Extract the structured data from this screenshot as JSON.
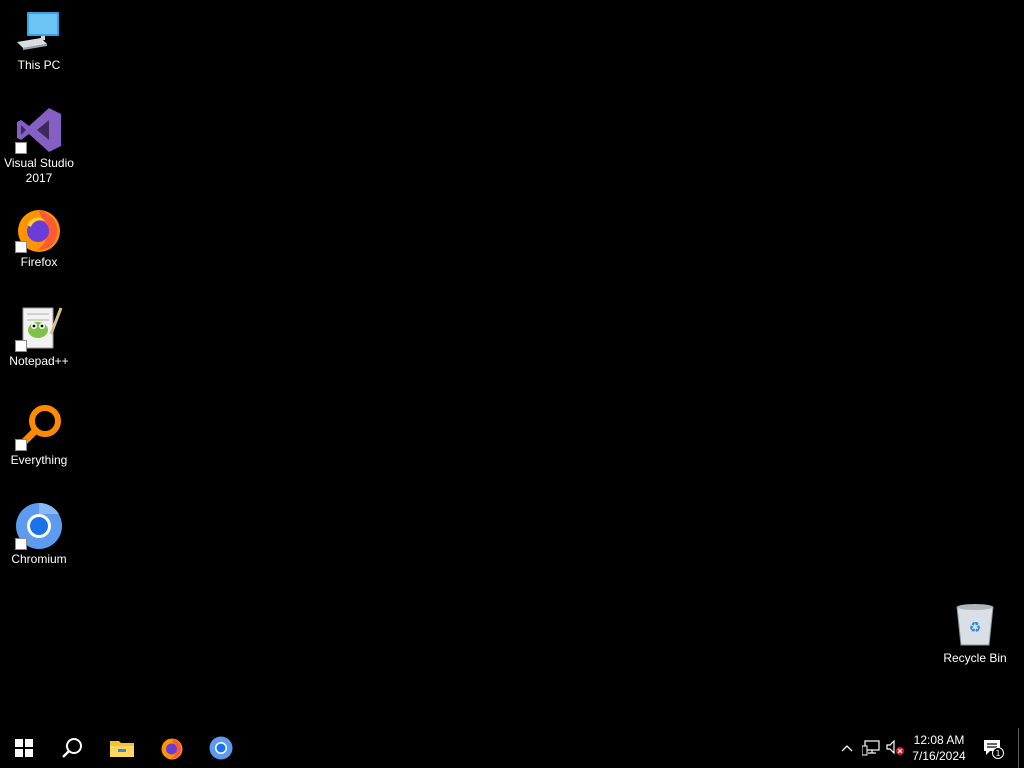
{
  "desktop": {
    "icons": [
      {
        "label": "This PC",
        "icon": "computer-icon"
      },
      {
        "label": "Visual Studio 2017",
        "icon": "visual-studio-icon"
      },
      {
        "label": "Firefox",
        "icon": "firefox-icon"
      },
      {
        "label": "Notepad++",
        "icon": "notepadpp-icon"
      },
      {
        "label": "Everything",
        "icon": "everything-icon"
      },
      {
        "label": "Chromium",
        "icon": "chromium-icon"
      }
    ],
    "recycle_bin": {
      "label": "Recycle Bin",
      "icon": "recycle-bin-icon"
    }
  },
  "taskbar": {
    "buttons": [
      {
        "icon": "windows-start-icon"
      },
      {
        "icon": "search-icon"
      },
      {
        "icon": "file-explorer-icon"
      },
      {
        "icon": "firefox-icon"
      },
      {
        "icon": "chromium-icon"
      }
    ],
    "tray": {
      "icons": [
        "chevron-up-icon",
        "network-icon",
        "volume-muted-icon"
      ],
      "time": "12:08 AM",
      "date": "7/16/2024",
      "notifications": {
        "icon": "action-center-icon",
        "count": "1"
      }
    }
  },
  "colors": {
    "background": "#000000",
    "text": "#ffffff",
    "visual_studio": "#865fc5",
    "firefox_orange": "#ff9400",
    "chromium_blue": "#1a73e8",
    "everything_orange": "#ff8a00",
    "explorer_yellow": "#f4c430"
  }
}
